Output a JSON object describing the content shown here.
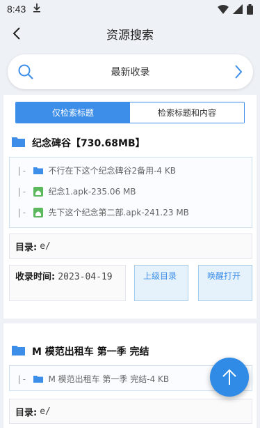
{
  "status": {
    "time": "8:43"
  },
  "header": {
    "title": "资源搜索"
  },
  "search": {
    "label": "最新收录"
  },
  "tabs": [
    {
      "label": "仅检索标题",
      "active": true
    },
    {
      "label": "检索标题和内容",
      "active": false
    }
  ],
  "results": [
    {
      "title": "纪念碑谷【730.68MB】",
      "files": [
        {
          "prefix": "|-",
          "icon": "folder-icon",
          "text": "不行在下这个纪念碑谷2备用-4 KB"
        },
        {
          "prefix": "|-",
          "icon": "android-icon",
          "text": "纪念1.apk-235.06 MB"
        },
        {
          "prefix": "|-",
          "icon": "android-icon",
          "text": "先下这个纪念第二部.apk-241.23 MB"
        }
      ],
      "dir_label": "目录:",
      "dir_value": "e/",
      "time_label": "收录时间:",
      "time_value": "2023-04-19",
      "parent_button": "上级目录",
      "open_button": "唤醒打开"
    },
    {
      "title": "M 模范出租车 第一季 完结",
      "files": [
        {
          "prefix": "|-",
          "icon": "folder-icon",
          "text": "M 模范出租车 第一季 完结-4 KB"
        }
      ],
      "dir_label": "目录:",
      "dir_value": "e/"
    }
  ],
  "colors": {
    "accent": "#3d8ee8",
    "fab": "#2f8be6",
    "background": "#eef1f6"
  }
}
